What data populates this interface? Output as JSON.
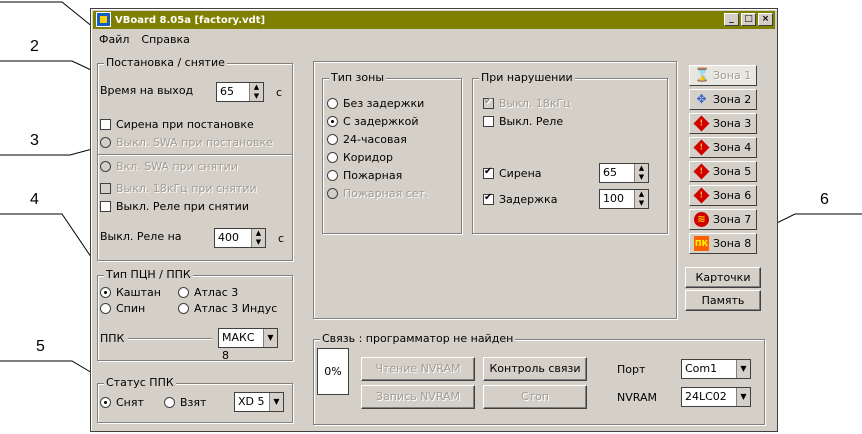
{
  "window": {
    "title": "VBoard 8.05a  [factory.vdt]",
    "buttons": [
      "_",
      "□",
      "×"
    ]
  },
  "menu": [
    "Файл",
    "Справка"
  ],
  "callouts": [
    "2",
    "3",
    "4",
    "5",
    "6"
  ],
  "arm": {
    "legend": "Постановка / снятие",
    "exit_time_label": "Время на выход",
    "exit_time_value": "65",
    "exit_time_unit": "с",
    "siren_on_arm": "Сирена при постановке",
    "swa_off_arm": "Выкл. SWA при постановке",
    "swa_on_disarm": "Вкл. SWA при снятии",
    "off_18khz_disarm": "Выкл. 18кГц при снятии",
    "relay_off_disarm": "Выкл. Реле при снятии",
    "relay_off_label": "Выкл. Реле на",
    "relay_off_value": "400",
    "relay_off_unit": "с"
  },
  "device_type": {
    "legend": "Тип ПЦН / ППК",
    "options": [
      "Каштан",
      "Атлас 3",
      "Спин",
      "Атлас 3 Индус"
    ],
    "ppk_label": "ППК",
    "ppk_value": "МАКС 8"
  },
  "status": {
    "legend": "Статус ППК",
    "options": [
      "Снят",
      "Взят"
    ],
    "model": "XD 5"
  },
  "zone_type": {
    "legend": "Тип зоны",
    "options": [
      "Без задержки",
      "С задержкой",
      "24-часовая",
      "Коридор",
      "Пожарная",
      "Пожарная сет."
    ]
  },
  "violation": {
    "legend": "При нарушении",
    "off_18khz": "Выкл. 18кГц",
    "relay_off": "Выкл. Реле",
    "siren_label": "Сирена",
    "siren_value": "65",
    "delay_label": "Задержка",
    "delay_value": "100"
  },
  "zones": [
    "Зона 1",
    "Зона 2",
    "Зона 3",
    "Зона 4",
    "Зона 5",
    "Зона 6",
    "Зона 7",
    "Зона 8"
  ],
  "side_buttons": {
    "cards": "Карточки",
    "memory": "Память"
  },
  "link": {
    "legend": "Связь : программатор не найден",
    "progress": "0%",
    "read_nvram": "Чтение NVRAM",
    "write_nvram": "Запись NVRAM",
    "link_check": "Контроль связи",
    "stop": "Стоп",
    "port_label": "Порт",
    "port_value": "Com1",
    "nvram_label": "NVRAM",
    "nvram_value": "24LC02"
  }
}
